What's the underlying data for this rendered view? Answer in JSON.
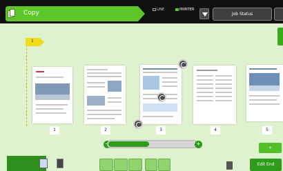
{
  "app": {
    "title": "Copy"
  },
  "status": {
    "line_label": "LINE",
    "printer_label": "PRINTER"
  },
  "toolbar": {
    "job_status_label": "Job Status"
  },
  "marker": {
    "label": "1"
  },
  "pages": [
    {
      "number": "1"
    },
    {
      "number": "2"
    },
    {
      "number": "3"
    },
    {
      "number": "4"
    },
    {
      "number": "5"
    }
  ],
  "slider": {
    "position_fraction": 0.45,
    "minus_label": "−",
    "plus_label": "+"
  },
  "side_button": {
    "label": "+"
  },
  "bottom": {
    "edit_end_label": "Edit End"
  },
  "colors": {
    "accent_green": "#5fc62a",
    "dark_green": "#2f9b1a",
    "background": "#dff2cf",
    "flag_yellow": "#f1da19"
  }
}
